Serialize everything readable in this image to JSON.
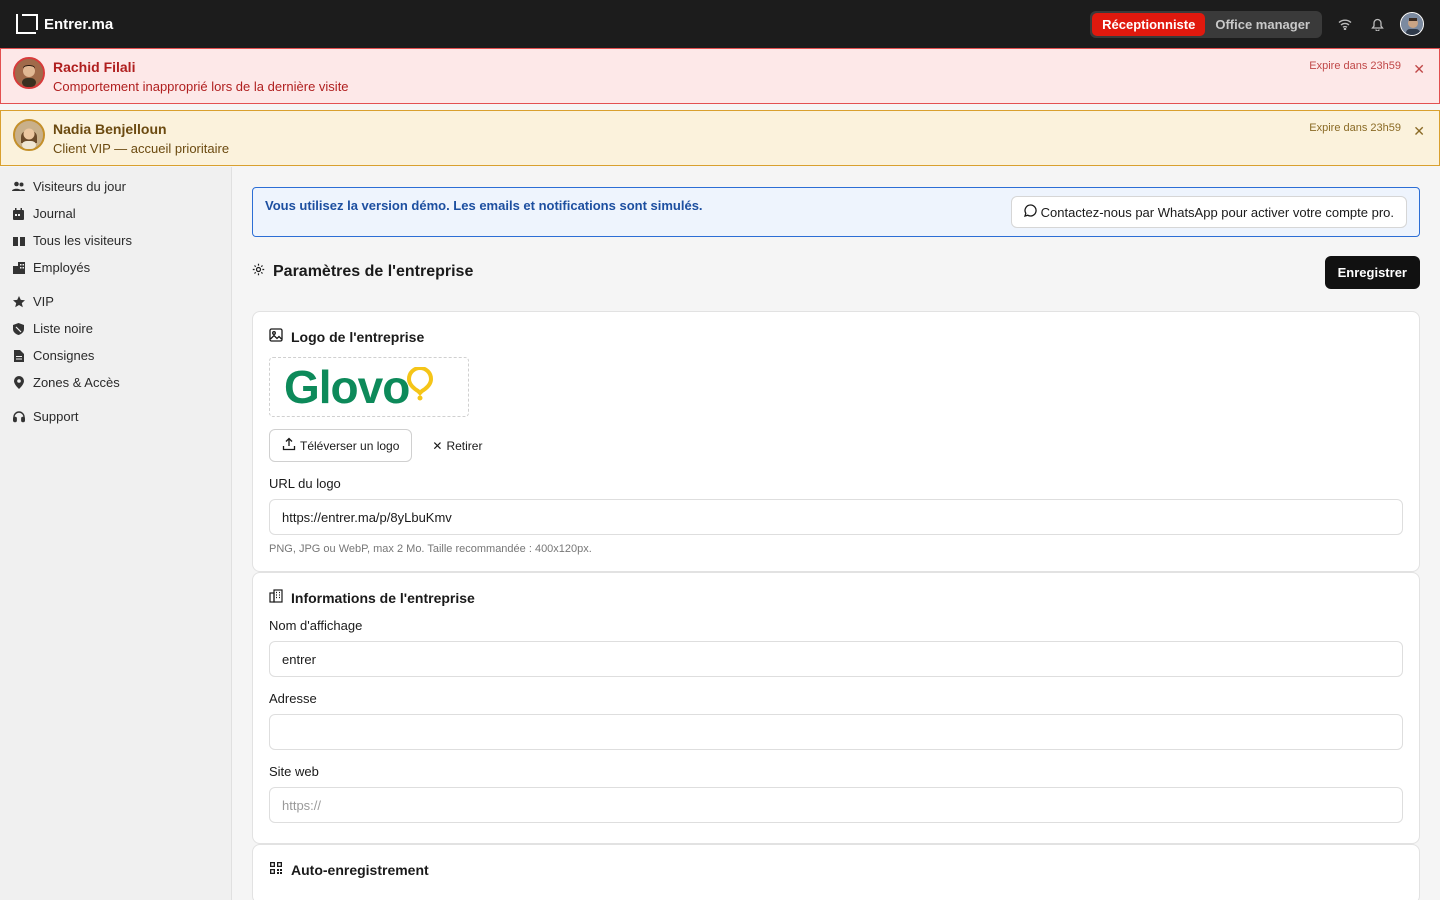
{
  "topbar": {
    "brand": "Entrer.ma",
    "roles": [
      "Réceptionniste",
      "Office manager"
    ],
    "active_role": "Réceptionniste",
    "icons": [
      "wifi-icon",
      "bell-icon",
      "avatar"
    ]
  },
  "alerts": [
    {
      "name": "Rachid Filali",
      "message": "Comportement inapproprié lors de la dernière visite",
      "expire": "Expire dans 23h59",
      "type": "blacklist",
      "color": "#e35050"
    },
    {
      "name": "Nadia Benjelloun",
      "message": "Client VIP — accueil prioritaire",
      "expire": "Expire dans 23h59",
      "type": "vip",
      "color": "#d9a02e"
    }
  ],
  "sidebar": {
    "items": [
      {
        "label": "Visiteurs du jour",
        "icon": "users-icon"
      },
      {
        "label": "Journal",
        "icon": "calendar-icon"
      },
      {
        "label": "Tous les visiteurs",
        "icon": "book-icon"
      },
      {
        "label": "Employés",
        "icon": "building-icon"
      },
      {
        "label": "VIP",
        "icon": "star-icon"
      },
      {
        "label": "Liste noire",
        "icon": "shield-icon"
      },
      {
        "label": "Consignes",
        "icon": "document-icon"
      },
      {
        "label": "Zones & Accès",
        "icon": "location-pin-icon"
      },
      {
        "label": "Support",
        "icon": "headset-icon"
      }
    ]
  },
  "banner": {
    "text": "Vous utilisez la version démo. Les emails et notifications sont simulés.",
    "whatsapp_label": "Contactez-nous par WhatsApp pour activer votre compte pro."
  },
  "page": {
    "title": "Paramètres de l'entreprise",
    "save_label": "Enregistrer"
  },
  "logo_card": {
    "title": "Logo de l'entreprise",
    "logo_text": "Glovo",
    "upload_label": "Téléverser un logo",
    "remove_label": "Retirer",
    "url_label": "URL du logo",
    "url_value": "https://entrer.ma/p/8yLbuKmv",
    "hint": "PNG, JPG ou WebP, max 2 Mo. Taille recommandée : 400x120px."
  },
  "info_card": {
    "title": "Informations de l'entreprise",
    "name_label": "Nom d'affichage",
    "name_value": "entrer",
    "address_label": "Adresse",
    "address_value": "",
    "website_label": "Site web",
    "website_placeholder": "https://"
  },
  "auto_card": {
    "title": "Auto-enregistrement"
  },
  "colors": {
    "accent_red": "#e0190e",
    "demo_blue": "#2c6ed5",
    "glovo_green": "#0d8a5a",
    "glovo_yellow": "#f5c518"
  }
}
